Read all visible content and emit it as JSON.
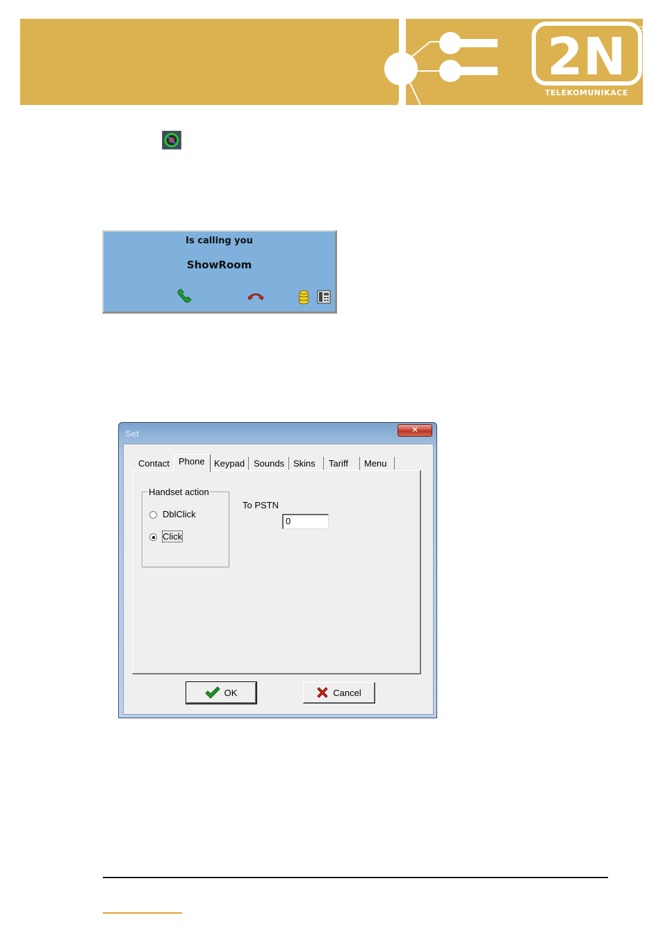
{
  "brand": {
    "logo_text": "2N",
    "tagline": "TELEKOMUNIKACE",
    "banner_color": "#dbb24f"
  },
  "call_popup": {
    "title": "Is calling you",
    "caller": "ShowRoom",
    "background_color": "#7fb1dc",
    "icons": [
      "accept-call-icon",
      "reject-call-icon",
      "coins-icon",
      "phone-book-icon"
    ]
  },
  "dialog": {
    "title": "Set",
    "close_label": "✕",
    "tabs": [
      {
        "label": "Contact",
        "active": false
      },
      {
        "label": "Phone",
        "active": true
      },
      {
        "label": "Keypad",
        "active": false
      },
      {
        "label": "Sounds",
        "active": false
      },
      {
        "label": "Skins",
        "active": false
      },
      {
        "label": "Tariff",
        "active": false
      },
      {
        "label": "Menu",
        "active": false
      }
    ],
    "handset_group": {
      "label": "Handset action",
      "options": [
        {
          "label": "DblClick",
          "selected": false
        },
        {
          "label": "Click",
          "selected": true
        }
      ]
    },
    "pstn": {
      "label": "To PSTN",
      "value": "0"
    },
    "buttons": {
      "ok": "OK",
      "cancel": "Cancel"
    }
  }
}
